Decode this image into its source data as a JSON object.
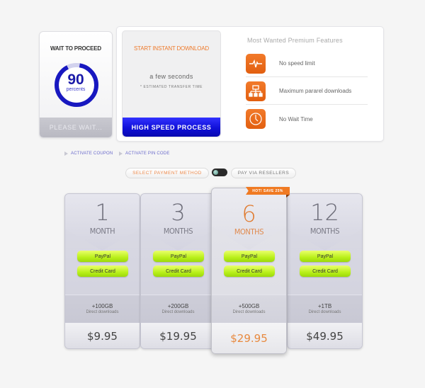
{
  "wait_card": {
    "title": "WAIT TO PROCEED",
    "progress_percent": 90,
    "progress_value": "90",
    "progress_unit": "percents",
    "status_button": "PLEASE WAIT..."
  },
  "download_card": {
    "title": "START INSTANT DOWNLOAD",
    "time": "a few seconds",
    "note": "* ESTIMATED TRANSFER TIME",
    "button": "HIGH SPEED PROCESS"
  },
  "features": {
    "title": "Most Wanted Premium Features",
    "items": [
      {
        "icon": "pulse-icon",
        "label": "No speed limit"
      },
      {
        "icon": "network-icon",
        "label": "Maximum pararel downloads"
      },
      {
        "icon": "clock-icon",
        "label": "No Wait Time"
      }
    ]
  },
  "links": {
    "coupon": "ACTIVATE COUPON",
    "pin": "ACTIVATE PIN CODE"
  },
  "payment_switch": {
    "left": "SELECT PAYMENT METHOD",
    "right": "PAY VIA RESELLERS"
  },
  "ribbon": "HOT! SAVE 25%",
  "plans": [
    {
      "number": "1",
      "unit": "MONTH",
      "paypal": "PayPal",
      "card": "Credit Card",
      "storage": "+100GB",
      "sub": "Direct downloads",
      "price": "$9.95"
    },
    {
      "number": "3",
      "unit": "MONTHS",
      "paypal": "PayPal",
      "card": "Credit Card",
      "storage": "+200GB",
      "sub": "Direct downloads",
      "price": "$19.95"
    },
    {
      "number": "6",
      "unit": "MONTHS",
      "paypal": "PayPal",
      "card": "Credit Card",
      "storage": "+500GB",
      "sub": "Direct downloads",
      "price": "$29.95",
      "featured": true
    },
    {
      "number": "12",
      "unit": "MONTHS",
      "paypal": "PayPal",
      "card": "Credit Card",
      "storage": "+1TB",
      "sub": "Direct downloads",
      "price": "$49.95"
    }
  ],
  "colors": {
    "accent_orange": "#f07a22",
    "accent_blue": "#1010d8",
    "button_green": "#b9f01a"
  }
}
